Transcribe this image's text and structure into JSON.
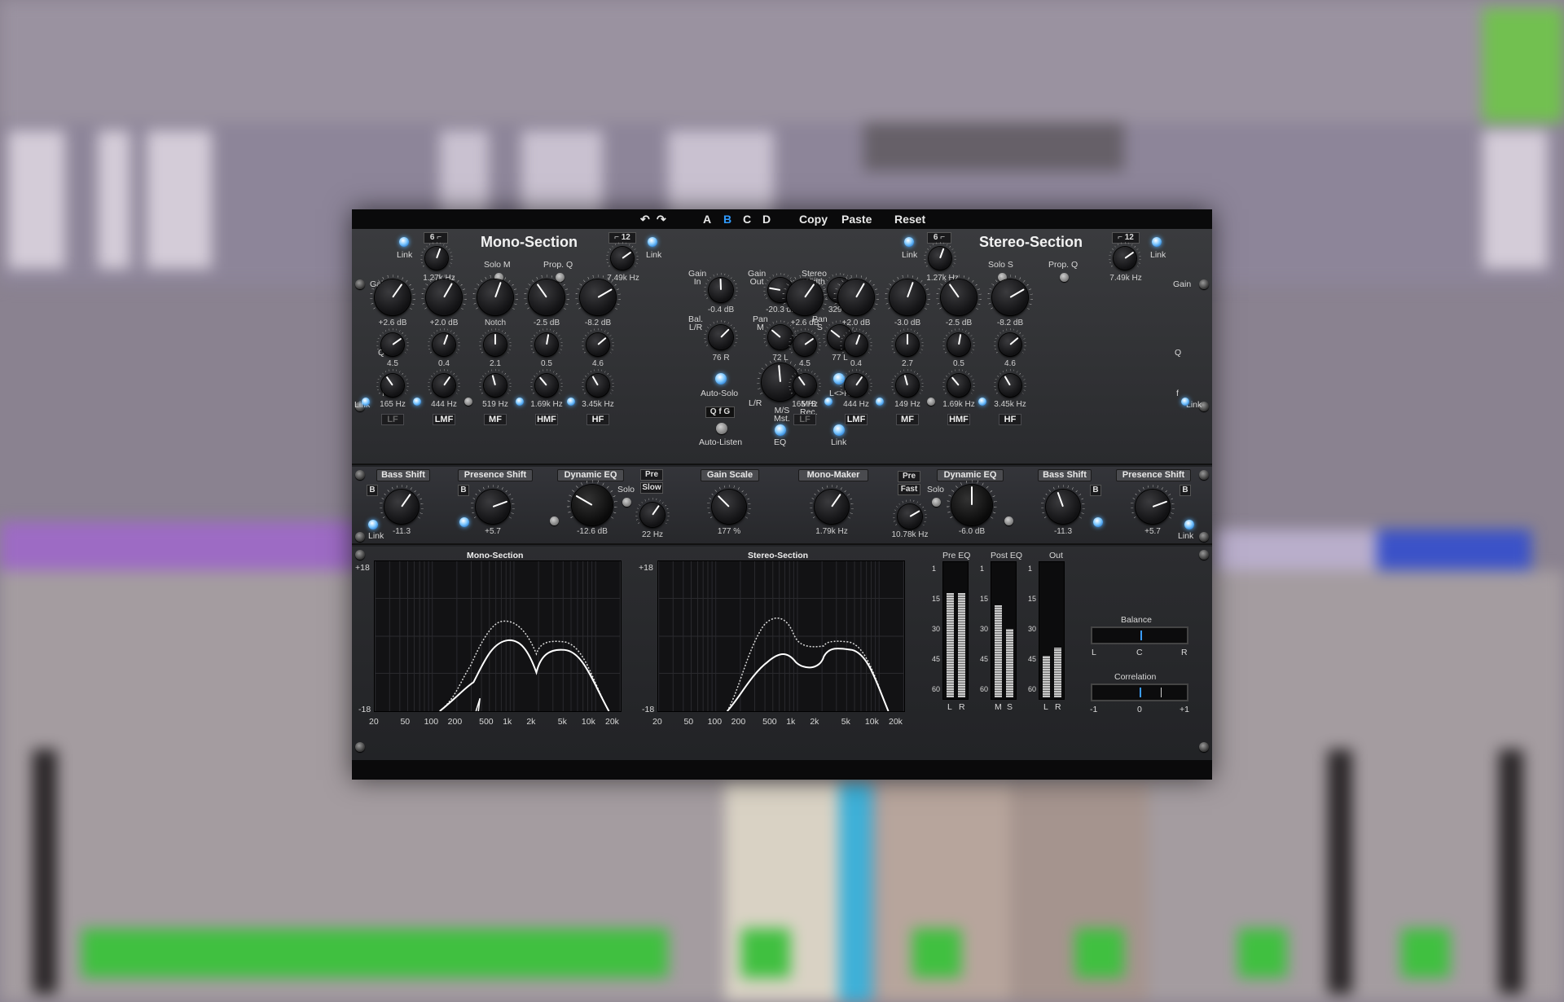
{
  "topbar": {
    "undo": "↶",
    "redo": "↷",
    "presets": [
      "A",
      "B",
      "C",
      "D"
    ],
    "active_preset": "B",
    "copy": "Copy",
    "paste": "Paste",
    "reset": "Reset"
  },
  "mono": {
    "title": "Mono-Section",
    "link": "Link",
    "hp_slope": "6",
    "lp_slope": "12",
    "hp_freq": "1.27k Hz",
    "lp_freq": "7.49k Hz",
    "solo": "Solo M",
    "prop_q": "Prop. Q",
    "gain_label": "Gain",
    "q_label": "Q",
    "f_label": "f",
    "gains": [
      "+2.6 dB",
      "+2.0 dB",
      "Notch",
      "-2.5 dB",
      "-8.2 dB"
    ],
    "qs": [
      "4.5",
      "0.4",
      "2.1",
      "0.5",
      "4.6"
    ],
    "freqs": [
      "165 Hz",
      "444 Hz",
      "519 Hz",
      "1.69k Hz",
      "3.45k Hz"
    ],
    "bands": [
      "LF",
      "LMF",
      "MF",
      "HMF",
      "HF"
    ]
  },
  "stereo": {
    "title": "Stereo-Section",
    "link": "Link",
    "hp_slope": "6",
    "lp_slope": "12",
    "hp_freq": "1.27k Hz",
    "lp_freq": "7.49k Hz",
    "solo": "Solo S",
    "prop_q": "Prop. Q",
    "gain_label": "Gain",
    "q_label": "Q",
    "f_label": "f",
    "gains": [
      "+2.6 dB",
      "+2.0 dB",
      "-3.0 dB",
      "-2.5 dB",
      "-8.2 dB"
    ],
    "qs": [
      "4.5",
      "0.4",
      "2.7",
      "0.5",
      "4.6"
    ],
    "freqs": [
      "165 Hz",
      "444 Hz",
      "149 Hz",
      "1.69k Hz",
      "3.45k Hz"
    ],
    "bands": [
      "LF",
      "LMF",
      "MF",
      "HMF",
      "HF"
    ]
  },
  "center": {
    "gain_in": "Gain\nIn",
    "gain_in_val": "-0.4 dB",
    "gain_out": "Gain\nOut",
    "gain_out_val": "-20.3 dB",
    "stereo_width": "Stereo\nWidth",
    "stereo_width_val": "329 %",
    "bal": "Bal.\nL/R",
    "bal_val": "76 R",
    "pan_m": "Pan\nM",
    "pan_m_val": "72 L",
    "pan_s": "Pan\nS",
    "pan_s_val": "77 L",
    "auto_solo": "Auto-Solo",
    "lr_swap": "L<>R",
    "lr": "L/R",
    "ms_mst": "M/S\nMst.",
    "ms_rec": "M/S\nRec.",
    "eq_mode": "Q f G",
    "auto_listen": "Auto-Listen",
    "eq": "EQ",
    "link": "Link"
  },
  "dynamics": {
    "bass_shift_l": "Bass Shift",
    "bass_shift_l_val": "-11.3",
    "b": "B",
    "presence_shift_l": "Presence Shift",
    "presence_shift_l_val": "+5.7",
    "dyn_eq_l": "Dynamic EQ",
    "dyn_eq_l_val": "-12.6 dB",
    "pre": "Pre",
    "slow": "Slow",
    "fast": "Fast",
    "solo": "Solo",
    "hz22": "22 Hz",
    "gain_scale": "Gain Scale",
    "gain_scale_val": "177 %",
    "mono_maker": "Mono-Maker",
    "mono_maker_val": "1.79k Hz",
    "thresh_r_val": "10.78k Hz",
    "dyn_eq_r": "Dynamic EQ",
    "dyn_eq_r_val": "-6.0 dB",
    "bass_shift_r": "Bass Shift",
    "bass_shift_r_val": "-11.3",
    "presence_shift_r": "Presence Shift",
    "presence_shift_r_val": "+5.7",
    "link": "Link"
  },
  "analyzer": {
    "mono_title": "Mono-Section",
    "stereo_title": "Stereo-Section",
    "top_db": "+18",
    "bottom_db": "-18",
    "freq_ticks": [
      "20",
      "50",
      "100",
      "200",
      "500",
      "1k",
      "2k",
      "5k",
      "10k",
      "20k"
    ],
    "pre_eq": "Pre EQ",
    "post_eq": "Post EQ",
    "out": "Out",
    "scale": [
      "1",
      "15",
      "30",
      "45",
      "60"
    ],
    "pre_lr": [
      "L",
      "R"
    ],
    "post_ms": [
      "M",
      "S"
    ],
    "out_lr": [
      "L",
      "R"
    ],
    "pre_levels": [
      0.78,
      0.78
    ],
    "post_levels": [
      0.69,
      0.51
    ],
    "out_levels": [
      0.31,
      0.37
    ],
    "balance": "Balance",
    "balance_ticks": [
      "L",
      "C",
      "R"
    ],
    "correlation": "Correlation",
    "corr_ticks": [
      "-1",
      "0",
      "+1"
    ]
  }
}
